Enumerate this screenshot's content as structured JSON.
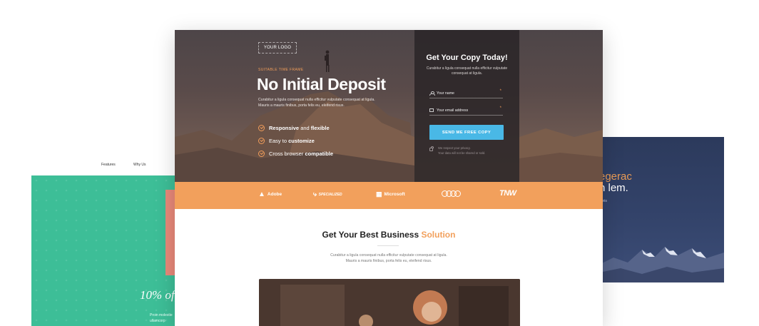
{
  "left_card": {
    "nav": [
      "Features",
      "Why Us"
    ],
    "offer_text": "10% off",
    "body_lines": [
      "Proin molestie",
      "ullamcorp"
    ]
  },
  "right_card": {
    "title_accent": "egerac",
    "title_line2": "n lem.",
    "small_text": "auris"
  },
  "hero": {
    "logo": "YOUR LOGO",
    "eyebrow": "SUITABLE TIME FRAME",
    "headline": "No Initial Deposit",
    "description": "Curabitur a ligula consequat nulla efficitur vulputate consequat at ligula. Mauris a mauris finibus, porta felis eu, eleifend risus.",
    "features": [
      {
        "bold_first": "Responsive",
        "rest": " and ",
        "bold_last": "flexible"
      },
      {
        "bold_first": "",
        "rest": "Easy to ",
        "bold_last": "customize"
      },
      {
        "bold_first": "",
        "rest": "Cross browser ",
        "bold_last": "compatible"
      }
    ]
  },
  "form": {
    "title": "Get Your Copy Today!",
    "subtitle": "Curabitur a ligula consequat nulla efficitur vulputate consequat at ligula.",
    "name_placeholder": "Your name",
    "email_placeholder": "Your email address",
    "required_mark": "*",
    "cta": "SEND ME FREE COPY",
    "privacy_line1": "We respect your privacy.",
    "privacy_line2": "Your data will not be shared or sold."
  },
  "brands": {
    "adobe": "Adobe",
    "specialized": "SPECIALIZED",
    "microsoft": "Microsoft",
    "tnw": "TNW"
  },
  "section": {
    "title_main": "Get Your Best Business ",
    "title_accent": "Solution",
    "desc_line1": "Curabitur a ligula consequat nulla efficitur vulputate consequat at ligula.",
    "desc_line2": "Mauris a mauris finibus, porta felis eu, eleifend risus."
  },
  "colors": {
    "accent_orange": "#f2a05c",
    "cta_blue": "#49b8e6",
    "teal": "#3dbe97",
    "navy": "#2c3a5c"
  }
}
